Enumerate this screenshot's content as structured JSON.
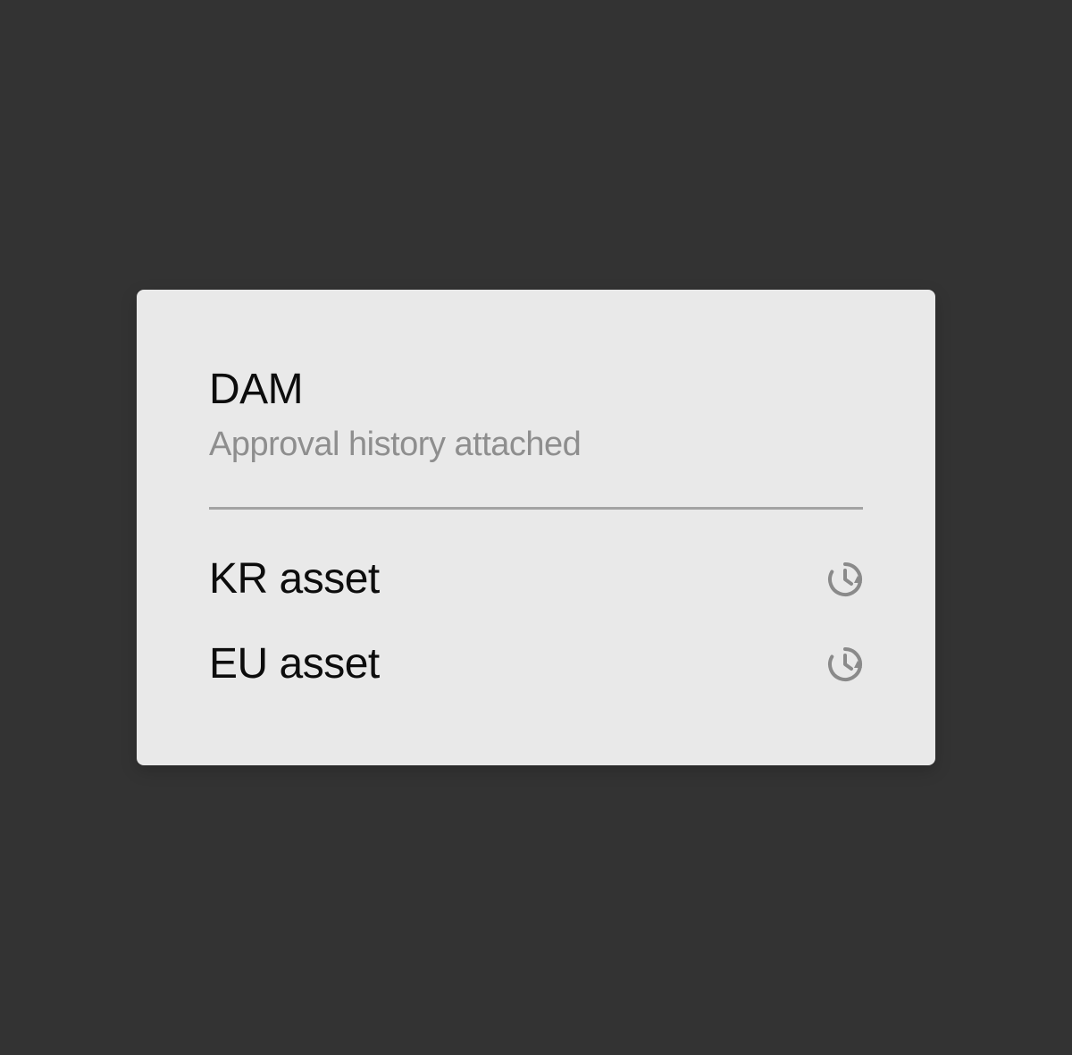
{
  "card": {
    "title": "DAM",
    "subtitle": "Approval history attached"
  },
  "assets": [
    {
      "label": "KR asset",
      "icon": "history-icon"
    },
    {
      "label": "EU asset",
      "icon": "history-icon"
    }
  ],
  "colors": {
    "background": "#333333",
    "card": "#e9e9e9",
    "text": "#0d0d0d",
    "muted": "#8e8e8e",
    "divider": "#a3a3a3",
    "icon": "#8a8a8a"
  }
}
